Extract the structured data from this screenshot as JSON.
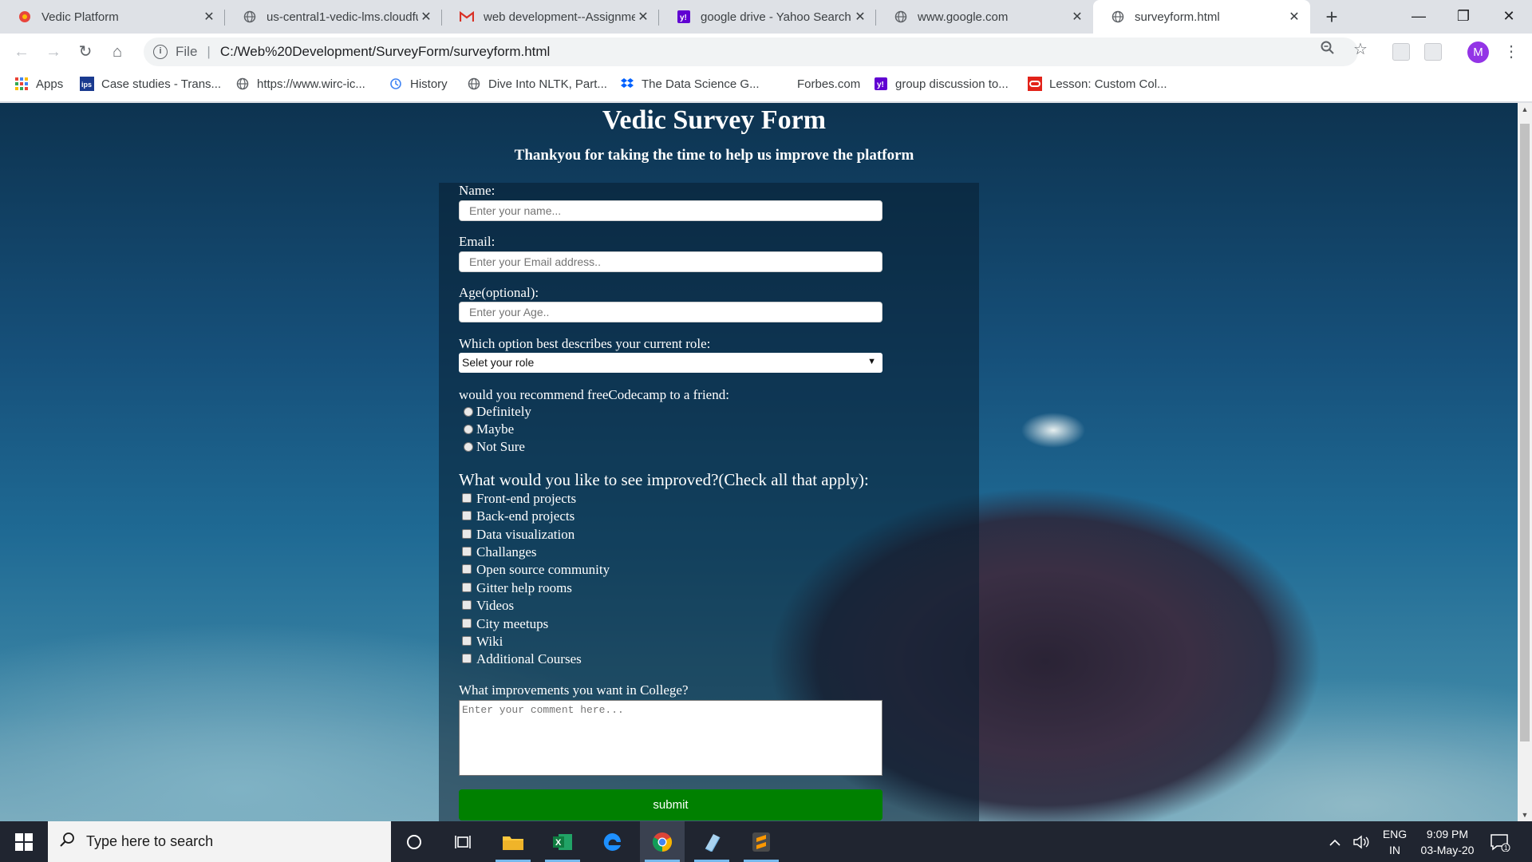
{
  "browser": {
    "tabs": [
      {
        "title": "Vedic Platform",
        "icon": "vedic-favicon-icon",
        "color": "#e8453c"
      },
      {
        "title": "us-central1-vedic-lms.cloudfu",
        "icon": "globe-icon"
      },
      {
        "title": "web development--Assignme",
        "icon": "gmail-icon",
        "color": "#d93025"
      },
      {
        "title": "google drive - Yahoo Search",
        "icon": "yahoo-icon",
        "color": "#6001d2"
      },
      {
        "title": "www.google.com",
        "icon": "globe-icon"
      },
      {
        "title": "surveyform.html",
        "icon": "globe-icon",
        "active": true
      }
    ],
    "address": {
      "scheme_label": "File",
      "url": "C:/Web%20Development/SurveyForm/surveyform.html"
    },
    "avatar_initial": "M",
    "bookmarks": [
      {
        "label": "Apps",
        "icon": "apps-grid-icon"
      },
      {
        "label": "Case studies - Trans...",
        "icon": "ips-icon"
      },
      {
        "label": "https://www.wirc-ic...",
        "icon": "globe-icon"
      },
      {
        "label": "History",
        "icon": "history-icon"
      },
      {
        "label": "Dive Into NLTK, Part...",
        "icon": "globe-icon"
      },
      {
        "label": "The Data Science G...",
        "icon": "dropbox-icon"
      },
      {
        "label": "Forbes.com",
        "icon": "blank-icon"
      },
      {
        "label": "group discussion to...",
        "icon": "yahoo-icon"
      },
      {
        "label": "Lesson: Custom Col...",
        "icon": "oracle-icon"
      }
    ]
  },
  "page": {
    "title": "Vedic Survey Form",
    "subtitle": "Thankyou for taking the time to help us improve the platform",
    "form": {
      "name_label": "Name:",
      "name_placeholder": "Enter your name...",
      "email_label": "Email:",
      "email_placeholder": "Enter your Email address..",
      "age_label": "Age(optional):",
      "age_placeholder": "Enter your Age..",
      "role_label": "Which option best describes your current role:",
      "role_selected": "Selet your role",
      "recommend_label": "would you recommend freeCodecamp to a friend:",
      "recommend_options": [
        "Definitely",
        "Maybe",
        "Not Sure"
      ],
      "improve_label": "What would you like to see improved?(Check all that apply):",
      "improve_options": [
        "Front-end projects",
        "Back-end projects",
        "Data visualization",
        "Challanges",
        "Open source community",
        "Gitter help rooms",
        "Videos",
        "City meetups",
        "Wiki",
        "Additional Courses"
      ],
      "comment_label": "What improvements you want in College?",
      "comment_placeholder": "Enter your comment here...",
      "submit_label": "submit",
      "submit_color": "#008000"
    }
  },
  "taskbar": {
    "search_placeholder": "Type here to search",
    "apps": [
      "cortana-icon",
      "task-view-icon",
      "file-explorer-icon",
      "excel-icon",
      "edge-icon",
      "chrome-icon",
      "notepad-icon",
      "sublime-text-icon"
    ],
    "lang_line1": "ENG",
    "lang_line2": "IN",
    "time": "9:09 PM",
    "date": "03-May-20",
    "notification_count": "1"
  }
}
